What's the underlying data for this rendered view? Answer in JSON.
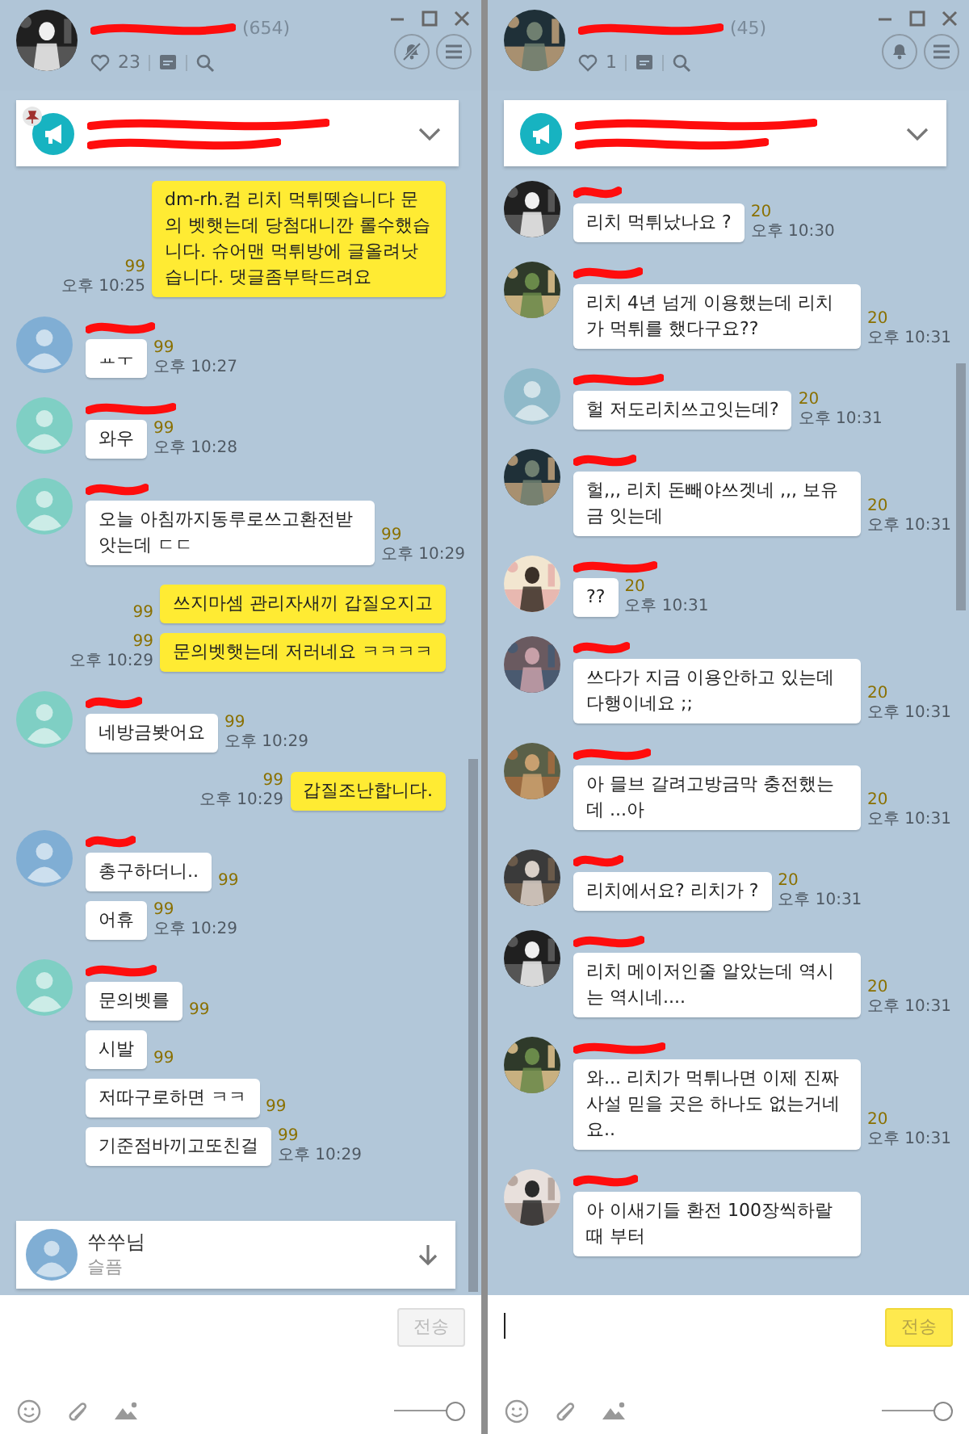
{
  "panels": [
    {
      "header": {
        "count": "(654)",
        "likes": "23",
        "muted": true
      },
      "notice": {
        "pinned": true
      },
      "groups": [
        {
          "kind": "sent",
          "bubbles": [
            {
              "text": "dm-rh.컴 리치  먹튀뗏습니다 문의 벳햇는데 당첨대니깐 롤수했습니다.  슈어맨 먹튀방에 글올려낫습니다. 댓글좀부탁드려요",
              "unread": "99",
              "time": "오후 10:25"
            }
          ]
        },
        {
          "kind": "received",
          "avatar": {
            "kind": "default",
            "color": "#80aed4"
          },
          "bubbles": [
            {
              "text": "ㅛㅜ",
              "unread": "99",
              "time": "오후 10:27"
            }
          ]
        },
        {
          "kind": "received",
          "avatar": {
            "kind": "default",
            "color": "#7fcfc4"
          },
          "bubbles": [
            {
              "text": "와우",
              "unread": "99",
              "time": "오후 10:28"
            }
          ]
        },
        {
          "kind": "received",
          "avatar": {
            "kind": "default",
            "color": "#7fcfc4"
          },
          "bubbles": [
            {
              "text": "오늘 아침까지동루로쓰고환전받앗는데 ㄷㄷ",
              "unread": "99",
              "time": "오후 10:29"
            }
          ]
        },
        {
          "kind": "sent",
          "bubbles": [
            {
              "text": "쓰지마셈 관리자새끼 갑질오지고",
              "unread": "99"
            },
            {
              "text": "문의벳햇는데 저러네요 ㅋㅋㅋㅋ",
              "unread": "99",
              "time": "오후 10:29"
            }
          ]
        },
        {
          "kind": "received",
          "avatar": {
            "kind": "default",
            "color": "#7fcfc4"
          },
          "bubbles": [
            {
              "text": "네방금봣어요",
              "unread": "99",
              "time": "오후 10:29"
            }
          ]
        },
        {
          "kind": "sent",
          "bubbles": [
            {
              "text": "갑질조난합니다.",
              "unread": "99",
              "time": "오후 10:29"
            }
          ]
        },
        {
          "kind": "received",
          "avatar": {
            "kind": "default",
            "color": "#80aed4"
          },
          "bubbles": [
            {
              "text": "총구하더니..",
              "unread": "99"
            },
            {
              "text": "어휴",
              "unread": "99",
              "time": "오후 10:29"
            }
          ]
        },
        {
          "kind": "received",
          "avatar": {
            "kind": "default",
            "color": "#7fcfc4"
          },
          "bubbles": [
            {
              "text": "문의벳를",
              "unread": "99"
            },
            {
              "text": "시발",
              "unread": "99"
            },
            {
              "text": "저따구로하면 ㅋㅋ",
              "unread": "99"
            },
            {
              "text": "기준점바끼고또친걸",
              "unread": "99",
              "time": "오후 10:29"
            }
          ]
        }
      ],
      "mention": {
        "name": "쑤쑤님",
        "text": "슬픔",
        "color": "#80aed4"
      },
      "input": {
        "send_label": "전송",
        "send_enabled": false,
        "level": 1
      }
    },
    {
      "header": {
        "count": "(45)",
        "likes": "1",
        "muted": false
      },
      "groups": [
        {
          "kind": "received",
          "avatar": {
            "kind": "picture"
          },
          "bubbles": [
            {
              "text": "리치 먹튀났나요 ?",
              "unread": "20",
              "time": "오후 10:30"
            }
          ]
        },
        {
          "kind": "received",
          "avatar": {
            "kind": "picture"
          },
          "bubbles": [
            {
              "text": "리치 4년 넘게 이용했는데 리치가  먹튀를 했다구요??",
              "unread": "20",
              "time": "오후 10:31"
            }
          ]
        },
        {
          "kind": "received",
          "avatar": {
            "kind": "default",
            "color": "#8fb9c9"
          },
          "bubbles": [
            {
              "text": "헐 저도리치쓰고잇는데?",
              "unread": "20",
              "time": "오후 10:31"
            }
          ]
        },
        {
          "kind": "received",
          "avatar": {
            "kind": "picture"
          },
          "bubbles": [
            {
              "text": "헐,,, 리치 돈빼야쓰겟네 ,,, 보유금 잇는데",
              "unread": "20",
              "time": "오후 10:31"
            }
          ]
        },
        {
          "kind": "received",
          "avatar": {
            "kind": "picture"
          },
          "bubbles": [
            {
              "text": "??",
              "unread": "20",
              "time": "오후 10:31"
            }
          ]
        },
        {
          "kind": "received",
          "avatar": {
            "kind": "picture"
          },
          "bubbles": [
            {
              "text": "쓰다가 지금 이용안하고 있는데다행이네요 ;;",
              "unread": "20",
              "time": "오후 10:31"
            }
          ]
        },
        {
          "kind": "received",
          "avatar": {
            "kind": "picture"
          },
          "bubbles": [
            {
              "text": "아 믈브 갈려고방금막 충전했는데 ...아",
              "unread": "20",
              "time": "오후 10:31"
            }
          ]
        },
        {
          "kind": "received",
          "avatar": {
            "kind": "picture"
          },
          "bubbles": [
            {
              "text": "리치에서요? 리치가 ?",
              "unread": "20",
              "time": "오후 10:31"
            }
          ]
        },
        {
          "kind": "received",
          "avatar": {
            "kind": "picture"
          },
          "bubbles": [
            {
              "text": "리치 메이저인줄 알았는데 역시는  역시네....",
              "unread": "20",
              "time": "오후 10:31"
            }
          ]
        },
        {
          "kind": "received",
          "avatar": {
            "kind": "picture"
          },
          "bubbles": [
            {
              "text": "와... 리치가 먹튀나면 이제 진짜 사설 믿을 곳은 하나도 없는거네요..",
              "unread": "20",
              "time": "오후 10:31"
            }
          ]
        },
        {
          "kind": "received",
          "avatar": {
            "kind": "picture"
          },
          "bubbles": [
            {
              "text": "아 이새기들 환전 100장씩하랄때 부터"
            }
          ]
        }
      ],
      "input": {
        "cursor": true,
        "send_label": "전송",
        "send_enabled": true,
        "level": 1
      }
    }
  ]
}
